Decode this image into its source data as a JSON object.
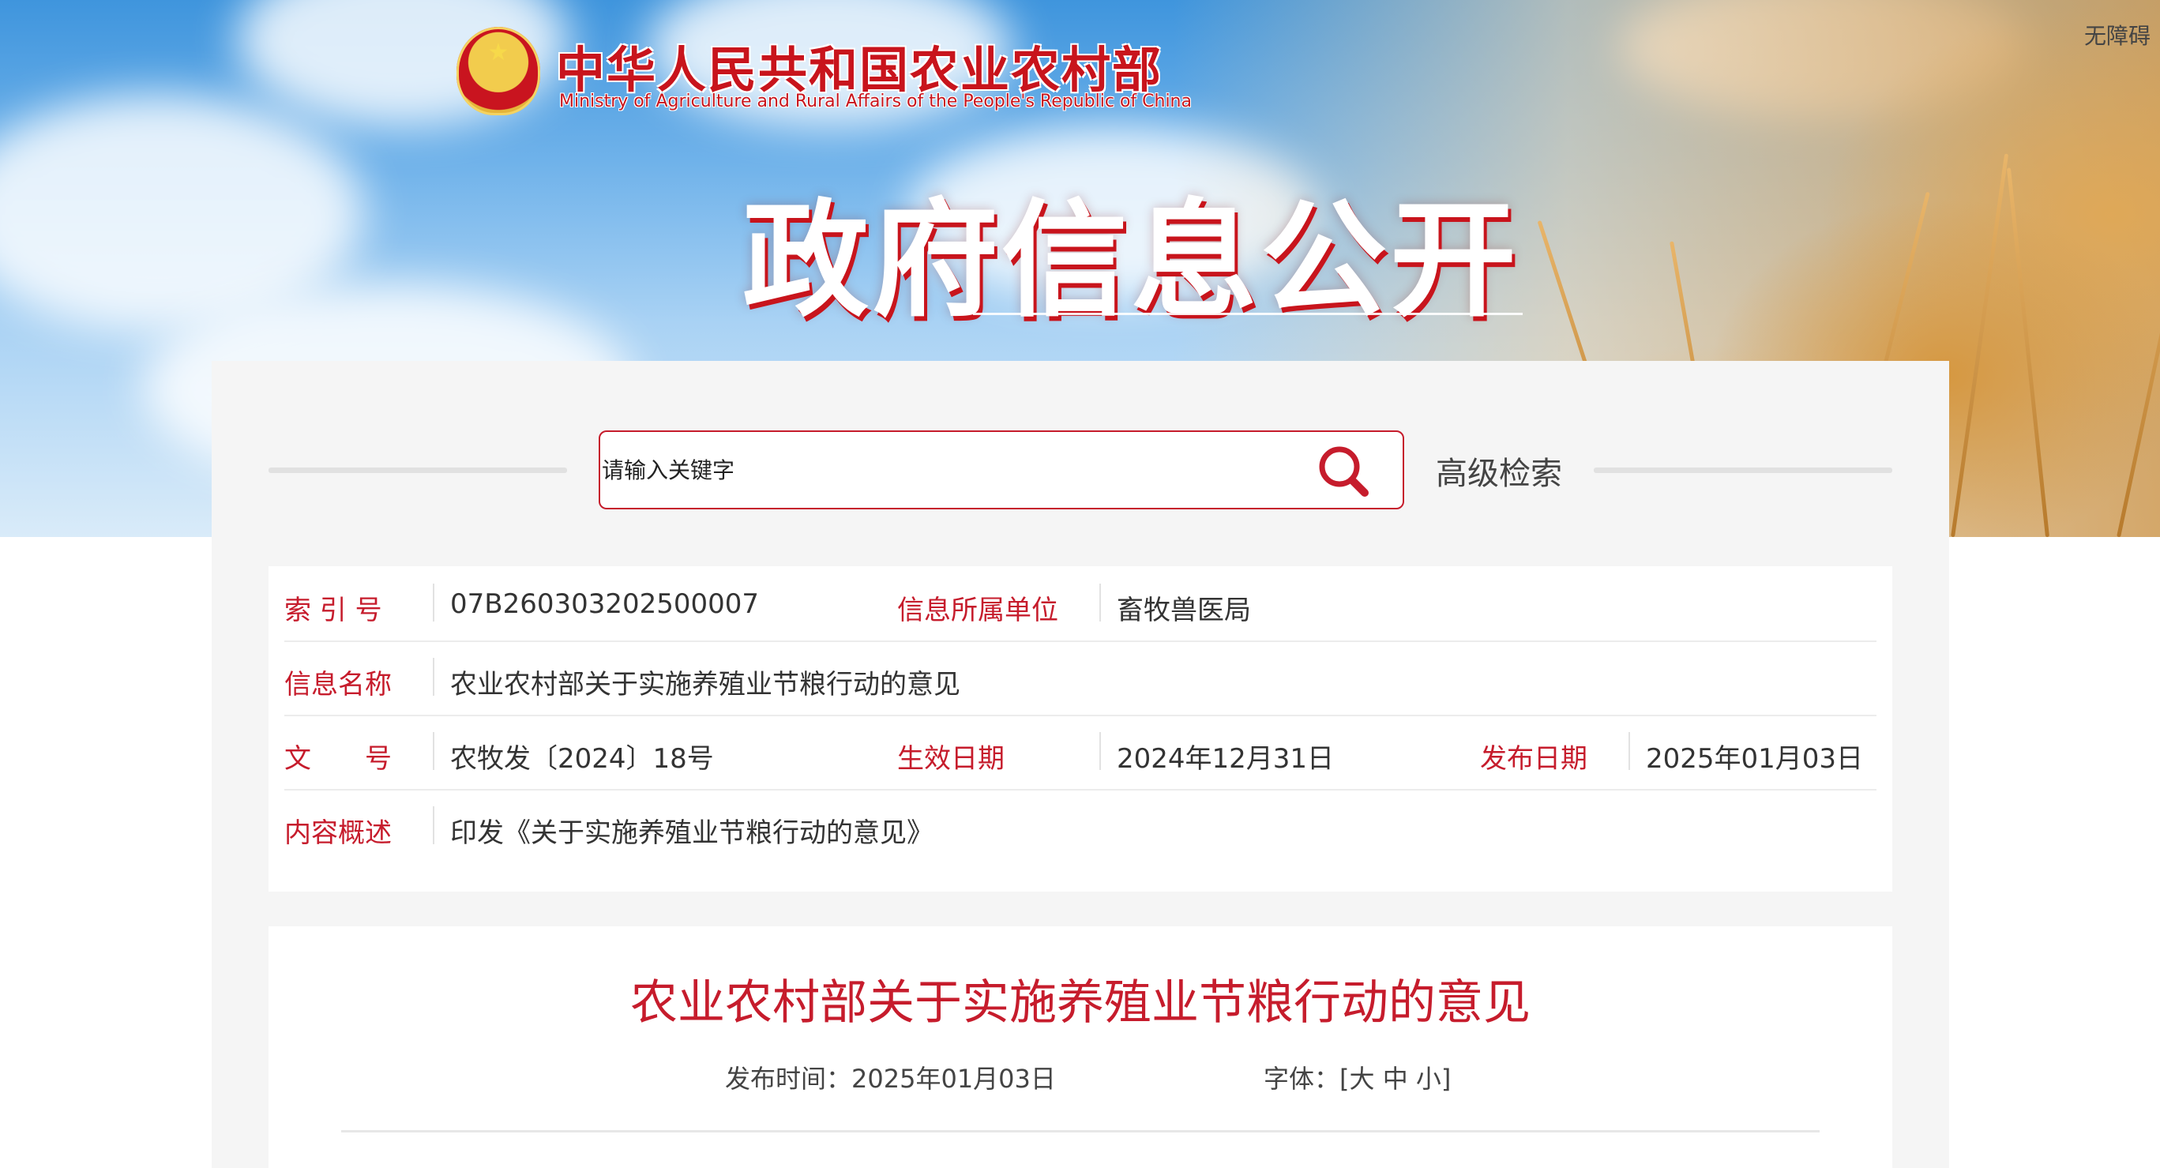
{
  "header": {
    "accessibility": "无障碍",
    "brand_cn": "中华人民共和国农业农村部",
    "brand_en": "Ministry of Agriculture and Rural Affairs of the People's Republic of China",
    "hero_title": "政府信息公开"
  },
  "search": {
    "placeholder": "请输入关键字",
    "button_icon": "search-icon",
    "advanced": "高级检索"
  },
  "meta": {
    "index_label": "索 引 号",
    "index_value": "07B260303202500007",
    "unit_label": "信息所属单位",
    "unit_value": "畜牧兽医局",
    "name_label": "信息名称",
    "name_value": "农业农村部关于实施养殖业节粮行动的意见",
    "doc_label": "文　　号",
    "doc_value": "农牧发〔2024〕18号",
    "effective_label": "生效日期",
    "effective_value": "2024年12月31日",
    "publish_label": "发布日期",
    "publish_value": "2025年01月03日",
    "summary_label": "内容概述",
    "summary_value": "印发《关于实施养殖业节粮行动的意见》"
  },
  "article": {
    "title": "农业农村部关于实施养殖业节粮行动的意见",
    "date_label": "发布时间：",
    "date_value": "2025年01月03日",
    "font_label": "字体：",
    "font_open": "[",
    "font_large": "大",
    "font_medium": "中",
    "font_small": "小",
    "font_close": "]"
  },
  "colors": {
    "accent_red": "#c61c2c",
    "panel_bg": "#f5f5f5"
  }
}
